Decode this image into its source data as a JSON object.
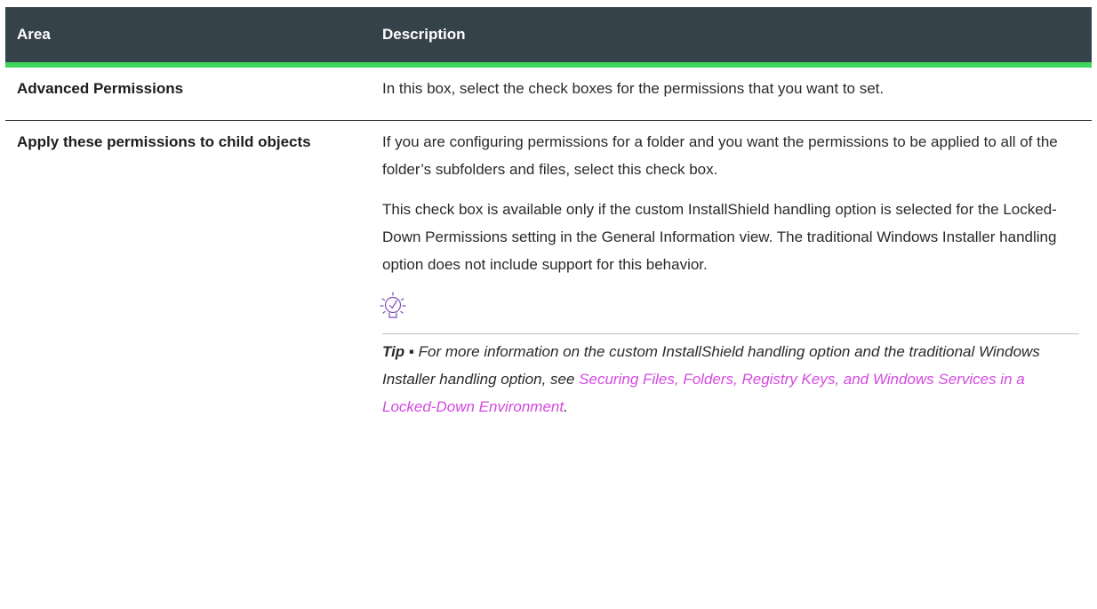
{
  "table": {
    "headers": {
      "area": "Area",
      "description": "Description"
    },
    "rows": [
      {
        "area": "Advanced Permissions",
        "description": "In this box, select the check boxes for the permissions that you want to set."
      },
      {
        "area": "Apply these permissions to child objects",
        "paragraphs": [
          "If you are configuring permissions for a folder and you want the permissions to be applied to all of the folder’s subfolders and files, select this check box.",
          "This check box is available only if the custom InstallShield handling option is selected for the Locked-Down Permissions setting in the General Information view. The traditional Windows Installer handling option does not include support for this behavior."
        ],
        "tip": {
          "icon": "lightbulb-check-icon",
          "label": "Tip ▪",
          "text": "For more information on the custom InstallShield handling option and the traditional Windows Installer handling option, see",
          "link": "Securing Files, Folders, Registry Keys, and Windows Services in a Locked-Down Environment",
          "end": "."
        }
      }
    ]
  },
  "colors": {
    "header_bg": "#36424a",
    "header_accent": "#3dd85b",
    "link": "#d44ae0"
  }
}
